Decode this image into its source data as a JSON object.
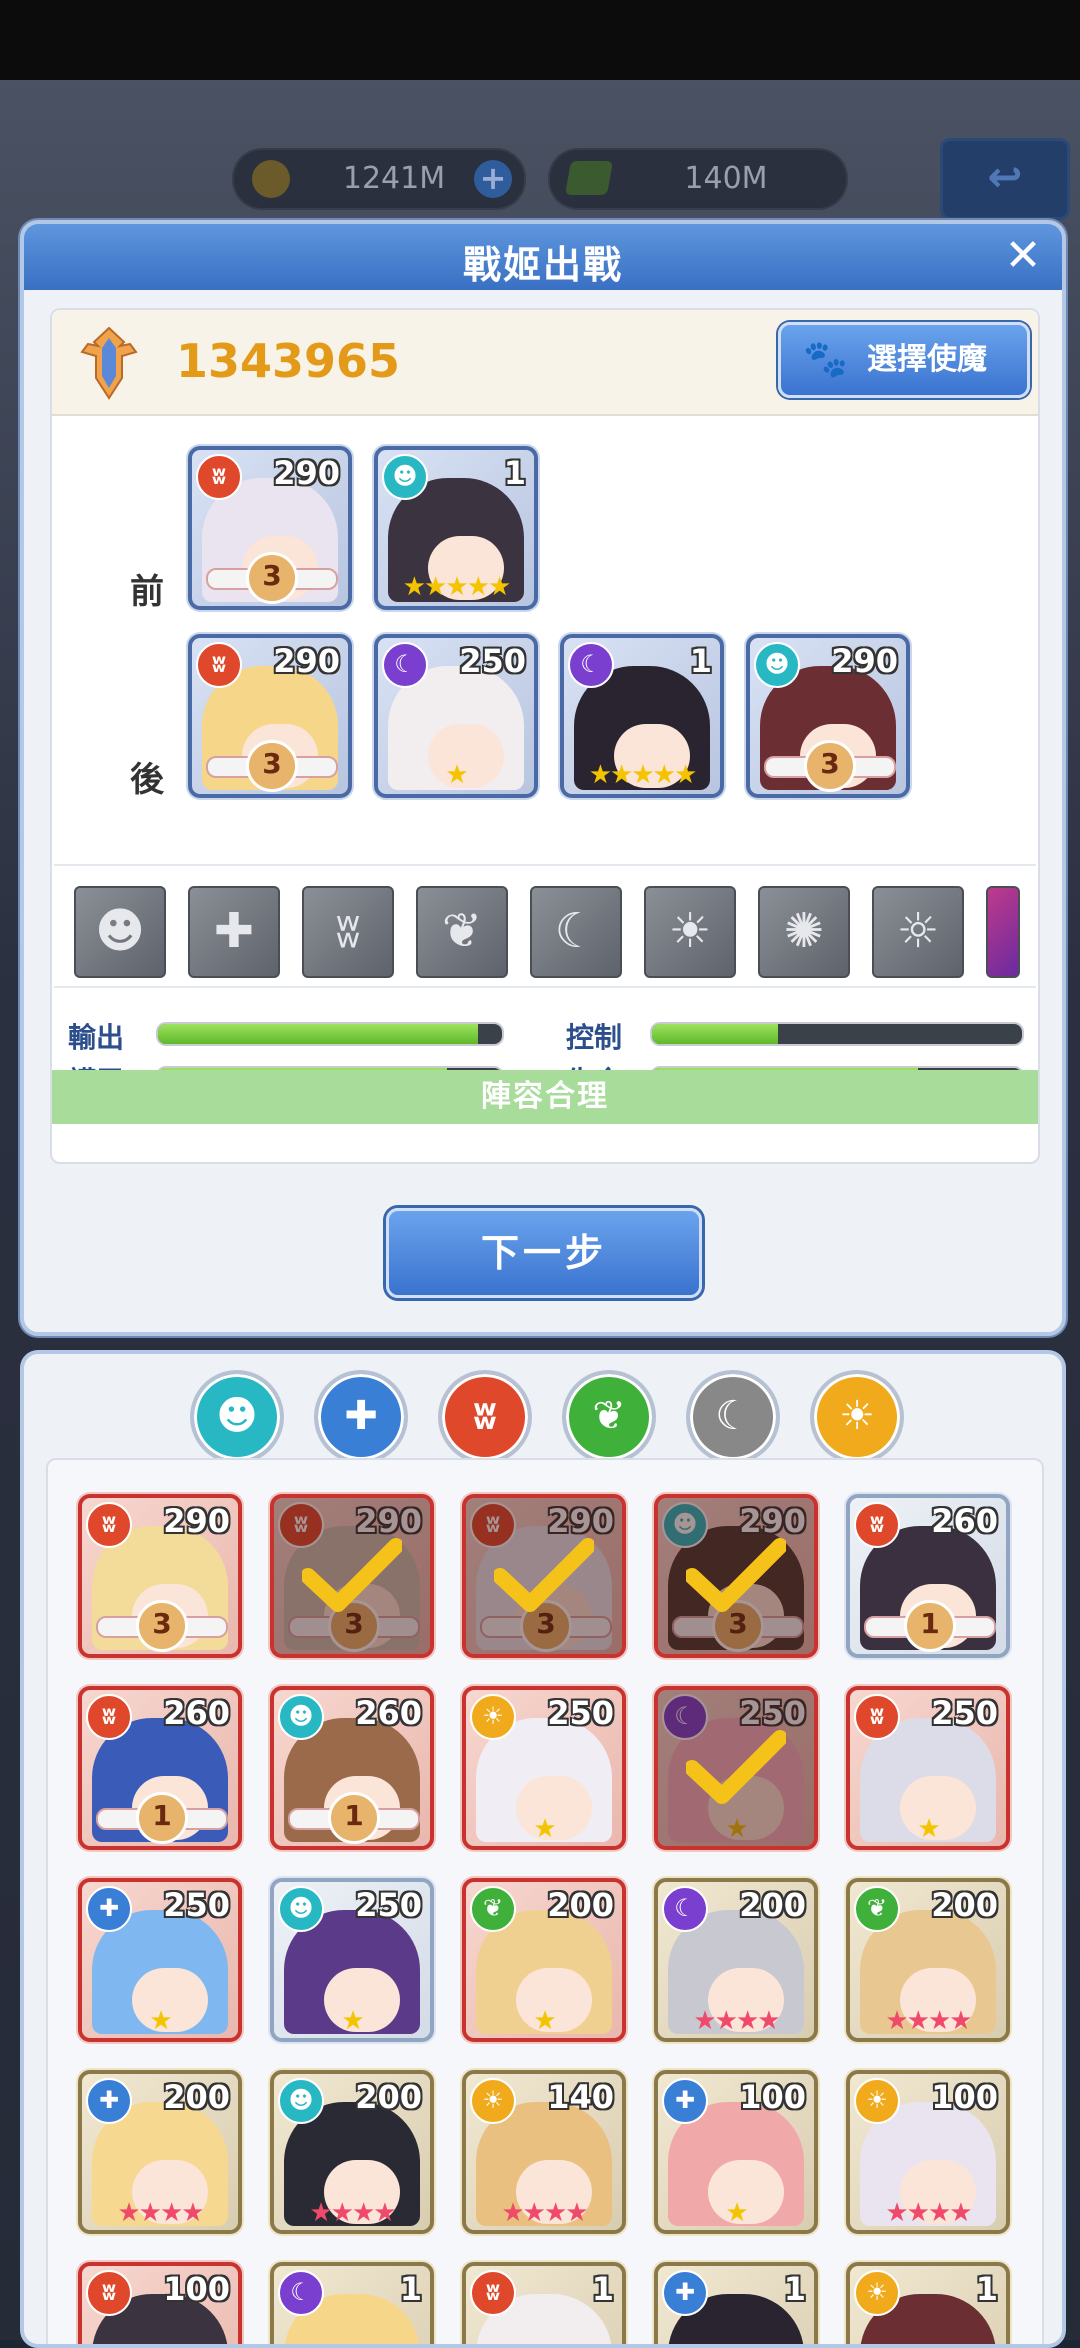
{
  "resources": {
    "coins": "1241M",
    "gems": "140M"
  },
  "dialog": {
    "title": "戰姬出戰",
    "power": "1343965",
    "demon_button": "選擇使魔"
  },
  "rows": {
    "front": "前 排",
    "back": "後 排"
  },
  "lineup": [
    {
      "row": "front",
      "level": "290",
      "element": "fire",
      "rank": "3",
      "stars": ""
    },
    {
      "row": "front",
      "level": "1",
      "element": "spirit",
      "rank": "",
      "stars": "★★★★★"
    },
    {
      "row": "back",
      "level": "290",
      "element": "fire",
      "rank": "3",
      "stars": ""
    },
    {
      "row": "back",
      "level": "250",
      "element": "dark",
      "rank": "",
      "stars": "★"
    },
    {
      "row": "back",
      "level": "1",
      "element": "dark",
      "rank": "",
      "stars": "★★★★★"
    },
    {
      "row": "back",
      "level": "290",
      "element": "spirit",
      "rank": "3",
      "stars": ""
    }
  ],
  "element_strip": [
    "spirit",
    "shield",
    "fire",
    "leaf",
    "moon",
    "sun",
    "vortex",
    "sun-moon",
    "partial"
  ],
  "stats": {
    "output": {
      "label": "輸出",
      "value": 0.93
    },
    "control": {
      "label": "控制",
      "value": 0.34
    },
    "armor": {
      "label": "護甲",
      "value": 0.84
    },
    "life": {
      "label": "生命",
      "value": 0.72
    }
  },
  "verdict": "陣容合理",
  "next_button": "下一步",
  "filters": [
    "spirit",
    "shield",
    "fire",
    "leaf",
    "moon",
    "sun"
  ],
  "roster": [
    {
      "level": "290",
      "element": "fire",
      "rank": "3",
      "stars": "",
      "frame": "red",
      "selected": false
    },
    {
      "level": "290",
      "element": "fire",
      "rank": "3",
      "stars": "",
      "frame": "red",
      "selected": true
    },
    {
      "level": "290",
      "element": "fire",
      "rank": "3",
      "stars": "",
      "frame": "red",
      "selected": true
    },
    {
      "level": "290",
      "element": "spirit",
      "rank": "3",
      "stars": "",
      "frame": "red",
      "selected": true
    },
    {
      "level": "260",
      "element": "fire",
      "rank": "1",
      "stars": "",
      "frame": "silver",
      "selected": false
    },
    {
      "level": "260",
      "element": "fire",
      "rank": "1",
      "stars": "",
      "frame": "red",
      "selected": false
    },
    {
      "level": "260",
      "element": "spirit",
      "rank": "1",
      "stars": "",
      "frame": "red",
      "selected": false
    },
    {
      "level": "250",
      "element": "sun",
      "rank": "",
      "stars": "★",
      "frame": "red",
      "selected": false
    },
    {
      "level": "250",
      "element": "dark",
      "rank": "",
      "stars": "★",
      "frame": "red",
      "selected": true
    },
    {
      "level": "250",
      "element": "fire",
      "rank": "",
      "stars": "★",
      "frame": "red",
      "selected": false
    },
    {
      "level": "250",
      "element": "shield",
      "rank": "",
      "stars": "★",
      "frame": "red",
      "selected": false
    },
    {
      "level": "250",
      "element": "spirit",
      "rank": "",
      "stars": "★",
      "frame": "silver",
      "selected": false
    },
    {
      "level": "200",
      "element": "leaf",
      "rank": "",
      "stars": "★",
      "frame": "red",
      "selected": false
    },
    {
      "level": "200",
      "element": "dark",
      "rank": "",
      "stars": "★★★★",
      "frame": "gold",
      "selected": false
    },
    {
      "level": "200",
      "element": "leaf",
      "rank": "",
      "stars": "★★★★",
      "frame": "gold",
      "selected": false
    },
    {
      "level": "200",
      "element": "shield",
      "rank": "",
      "stars": "★★★★",
      "frame": "gold",
      "selected": false
    },
    {
      "level": "200",
      "element": "spirit",
      "rank": "",
      "stars": "★★★★",
      "frame": "gold",
      "selected": false
    },
    {
      "level": "140",
      "element": "sun",
      "rank": "",
      "stars": "★★★★",
      "frame": "gold",
      "selected": false
    },
    {
      "level": "100",
      "element": "shield",
      "rank": "",
      "stars": "★",
      "frame": "gold",
      "selected": false
    },
    {
      "level": "100",
      "element": "sun",
      "rank": "",
      "stars": "★★★★",
      "frame": "gold",
      "selected": false
    },
    {
      "level": "100",
      "element": "fire",
      "rank": "",
      "stars": "",
      "frame": "red",
      "selected": false
    },
    {
      "level": "1",
      "element": "dark",
      "rank": "",
      "stars": "",
      "frame": "gold",
      "selected": false
    },
    {
      "level": "1",
      "element": "fire",
      "rank": "",
      "stars": "",
      "frame": "gold",
      "selected": false
    },
    {
      "level": "1",
      "element": "shield",
      "rank": "",
      "stars": "",
      "frame": "gold",
      "selected": false
    },
    {
      "level": "1",
      "element": "sun",
      "rank": "",
      "stars": "",
      "frame": "gold",
      "selected": false
    }
  ],
  "colors": {
    "fire": "#e0482c",
    "spirit": "#27b8c4",
    "dark": "#7b3fd0",
    "leaf": "#3fb13a",
    "sun": "#f0aa1c",
    "shield": "#3a7fd6",
    "accent": "#3a73cf",
    "power": "#e39a18"
  }
}
